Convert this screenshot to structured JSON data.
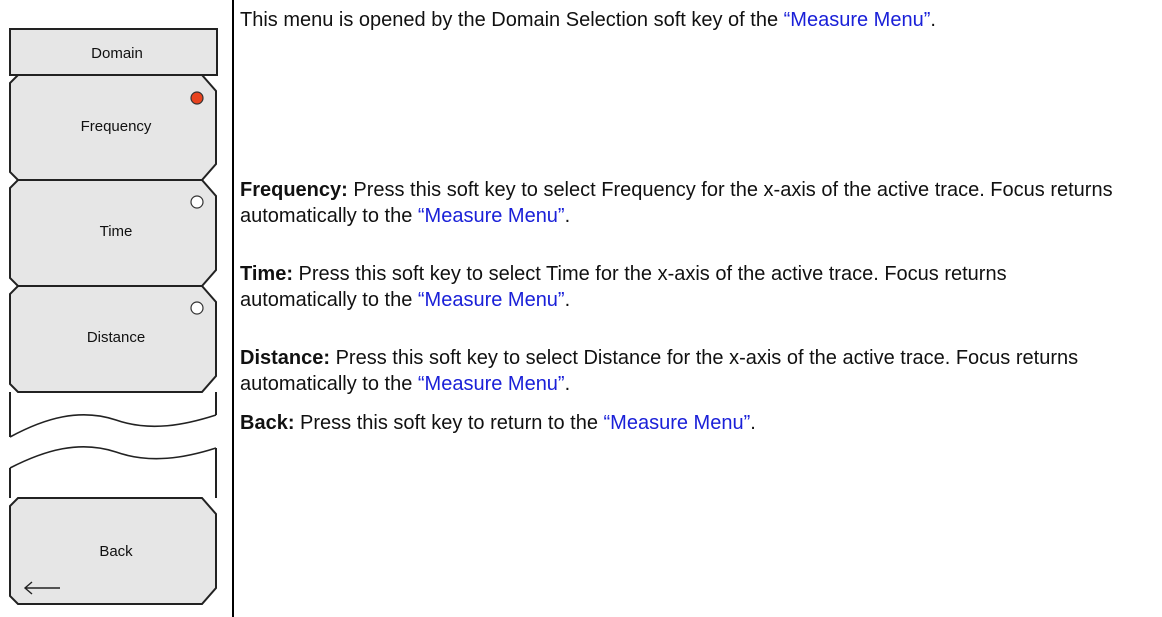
{
  "menu": {
    "title": "Domain",
    "keys": [
      {
        "label": "Frequency",
        "selected": true
      },
      {
        "label": "Time",
        "selected": false
      },
      {
        "label": "Distance",
        "selected": false
      }
    ],
    "back_label": "Back",
    "back_icon": "left-arrow-icon",
    "selected_indicator_color": "#e8431f"
  },
  "description": {
    "intro_text": "This menu is opened by the Domain Selection soft key of the ",
    "intro_link": "“Measure Menu”",
    "intro_end": ".",
    "items": [
      {
        "term": "Frequency:",
        "text": " Press this soft key to select Frequency for the x-axis of the active trace. Focus returns automatically to the ",
        "link": "“Measure Menu”",
        "end": "."
      },
      {
        "term": "Time:",
        "text": " Press this soft key to select Time for the x-axis of the active trace. Focus returns automatically to the ",
        "link": "“Measure Menu”",
        "end": "."
      },
      {
        "term": "Distance:",
        "text": " Press this soft key to select Distance for the x-axis of the active trace. Focus returns automatically to the ",
        "link": "“Measure Menu”",
        "end": "."
      },
      {
        "term": "Back:",
        "text": " Press this soft key to return to the ",
        "link": "“Measure Menu”",
        "end": "."
      }
    ]
  },
  "colors": {
    "link": "#1a20d8",
    "key_fill": "#e6e6e6"
  }
}
